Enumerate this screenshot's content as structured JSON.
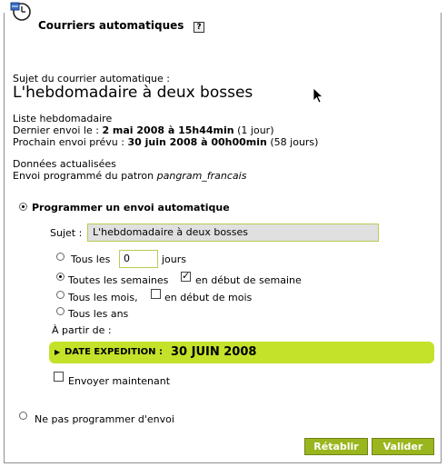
{
  "window": {
    "title": "Courriers automatiques",
    "help_label": "?"
  },
  "subject_section": {
    "label": "Sujet du courrier automatique :",
    "title": "L'hebdomadaire à deux bosses"
  },
  "info": {
    "list_name": "Liste hebdomadaire",
    "last_send_prefix": "Dernier envoi le : ",
    "last_send_value": "2 mai 2008 à 15h44min",
    "last_send_suffix": " (1 jour)",
    "next_send_prefix": "Prochain envoi prévu : ",
    "next_send_value": "30 juin 2008 à 00h00min",
    "next_send_suffix": " (58 jours)",
    "data_status": "Données actualisées",
    "template_prefix": "Envoi programmé du patron ",
    "template_name": "pangram_francais"
  },
  "schedule": {
    "option_label": "Programmer un envoi automatique",
    "subject_label": "Sujet :",
    "subject_value": "L'hebdomadaire à deux bosses",
    "every_prefix": "Tous les",
    "every_value": "0",
    "every_suffix": "jours",
    "weekly_label": "Toutes les semaines",
    "weekly_start_label": "en début de semaine",
    "monthly_label": "Tous les mois,",
    "monthly_start_label": "en début de mois",
    "yearly_label": "Tous les ans",
    "from_label": "À partir de :",
    "date_label": "DATE EXPEDITION :",
    "date_value": "30 JUIN 2008",
    "send_now_label": "Envoyer maintenant"
  },
  "no_schedule": {
    "option_label": "Ne pas programmer d'envoi"
  },
  "buttons": {
    "reset": "Rétablir",
    "submit": "Valider"
  },
  "icons": [
    "calendar-clock-icon",
    "help-icon",
    "arrow-right-icon",
    "mouse-cursor-icon"
  ]
}
